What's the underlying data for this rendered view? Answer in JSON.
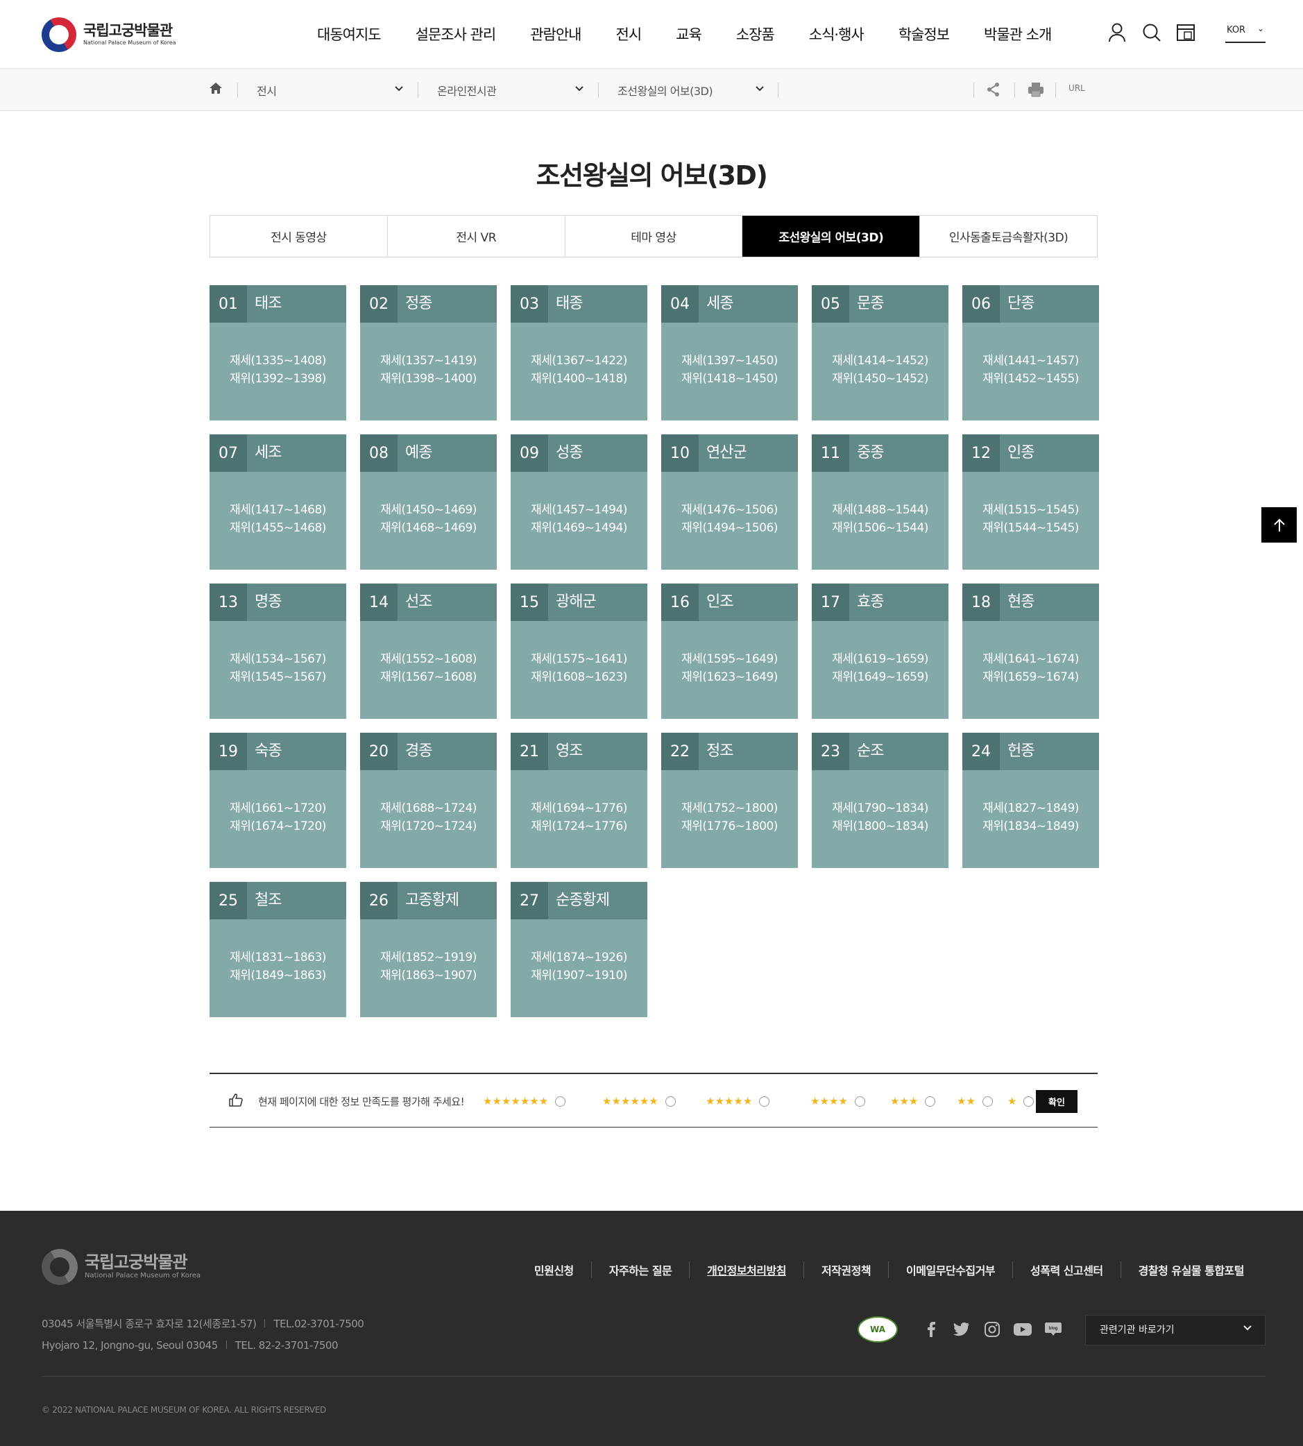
{
  "header": {
    "logo_ko": "국립고궁박물관",
    "logo_en": "National Palace Museum of Korea",
    "nav": [
      "대동여지도",
      "설문조사 관리",
      "관람안내",
      "전시",
      "교육",
      "소장품",
      "소식·행사",
      "학술정보",
      "박물관 소개"
    ],
    "lang": "KOR"
  },
  "breadcrumb": {
    "items": [
      "전시",
      "온라인전시관",
      "조선왕실의 어보(3D)"
    ],
    "url_label": "URL"
  },
  "page": {
    "title": "조선왕실의 어보(3D)",
    "tabs": [
      "전시 동영상",
      "전시 VR",
      "테마 영상",
      "조선왕실의 어보(3D)",
      "인사동출토금속활자(3D)"
    ],
    "active_tab": 3
  },
  "kings": [
    {
      "num": "01",
      "name": "태조",
      "life": "재세(1335~1408)",
      "reign": "재위(1392~1398)"
    },
    {
      "num": "02",
      "name": "정종",
      "life": "재세(1357~1419)",
      "reign": "재위(1398~1400)"
    },
    {
      "num": "03",
      "name": "태종",
      "life": "재세(1367~1422)",
      "reign": "재위(1400~1418)"
    },
    {
      "num": "04",
      "name": "세종",
      "life": "재세(1397~1450)",
      "reign": "재위(1418~1450)"
    },
    {
      "num": "05",
      "name": "문종",
      "life": "재세(1414~1452)",
      "reign": "재위(1450~1452)"
    },
    {
      "num": "06",
      "name": "단종",
      "life": "재세(1441~1457)",
      "reign": "재위(1452~1455)"
    },
    {
      "num": "07",
      "name": "세조",
      "life": "재세(1417~1468)",
      "reign": "재위(1455~1468)"
    },
    {
      "num": "08",
      "name": "예종",
      "life": "재세(1450~1469)",
      "reign": "재위(1468~1469)"
    },
    {
      "num": "09",
      "name": "성종",
      "life": "재세(1457~1494)",
      "reign": "재위(1469~1494)"
    },
    {
      "num": "10",
      "name": "연산군",
      "life": "재세(1476~1506)",
      "reign": "재위(1494~1506)"
    },
    {
      "num": "11",
      "name": "중종",
      "life": "재세(1488~1544)",
      "reign": "재위(1506~1544)"
    },
    {
      "num": "12",
      "name": "인종",
      "life": "재세(1515~1545)",
      "reign": "재위(1544~1545)"
    },
    {
      "num": "13",
      "name": "명종",
      "life": "재세(1534~1567)",
      "reign": "재위(1545~1567)"
    },
    {
      "num": "14",
      "name": "선조",
      "life": "재세(1552~1608)",
      "reign": "재위(1567~1608)"
    },
    {
      "num": "15",
      "name": "광해군",
      "life": "재세(1575~1641)",
      "reign": "재위(1608~1623)"
    },
    {
      "num": "16",
      "name": "인조",
      "life": "재세(1595~1649)",
      "reign": "재위(1623~1649)"
    },
    {
      "num": "17",
      "name": "효종",
      "life": "재세(1619~1659)",
      "reign": "재위(1649~1659)"
    },
    {
      "num": "18",
      "name": "현종",
      "life": "재세(1641~1674)",
      "reign": "재위(1659~1674)"
    },
    {
      "num": "19",
      "name": "숙종",
      "life": "재세(1661~1720)",
      "reign": "재위(1674~1720)"
    },
    {
      "num": "20",
      "name": "경종",
      "life": "재세(1688~1724)",
      "reign": "재위(1720~1724)"
    },
    {
      "num": "21",
      "name": "영조",
      "life": "재세(1694~1776)",
      "reign": "재위(1724~1776)"
    },
    {
      "num": "22",
      "name": "정조",
      "life": "재세(1752~1800)",
      "reign": "재위(1776~1800)"
    },
    {
      "num": "23",
      "name": "순조",
      "life": "재세(1790~1834)",
      "reign": "재위(1800~1834)"
    },
    {
      "num": "24",
      "name": "헌종",
      "life": "재세(1827~1849)",
      "reign": "재위(1834~1849)"
    },
    {
      "num": "25",
      "name": "철조",
      "life": "재세(1831~1863)",
      "reign": "재위(1849~1863)"
    },
    {
      "num": "26",
      "name": "고종황제",
      "life": "재세(1852~1919)",
      "reign": "재위(1863~1907)"
    },
    {
      "num": "27",
      "name": "순종황제",
      "life": "재세(1874~1926)",
      "reign": "재위(1907~1910)"
    }
  ],
  "rating": {
    "question": "현재 페이지에 대한 정보 만족도를 평가해 주세요!",
    "options": [
      7,
      6,
      5,
      4,
      3,
      2,
      1
    ],
    "confirm": "확인"
  },
  "footer": {
    "logo_ko": "국립고궁박물관",
    "logo_en": "National Palace Museum of Korea",
    "links": [
      "민원신청",
      "자주하는 질문",
      "개인정보처리방침",
      "저작권정책",
      "이메일무단수집거부",
      "성폭력 신고센터",
      "경찰청 유실물 통합포털"
    ],
    "addr_ko": "03045 서울특별시 종로구 효자로 12(세종로1-57)",
    "tel_ko": "TEL.02-3701-7500",
    "addr_en": "Hyojaro 12, Jongno-gu, Seoul 03045",
    "tel_en": "TEL. 82-2-3701-7500",
    "wa_label": "WA",
    "related": "관련기관 바로가기",
    "copyright": "© 2022 NATIONAL PALACE MUSEUM OF KOREA. ALL RIGHTS RESERVED"
  },
  "colors": {
    "card_body": "#84aaa8",
    "card_head": "#628a89",
    "card_num": "#4d7371",
    "star": "#f3b51b"
  }
}
